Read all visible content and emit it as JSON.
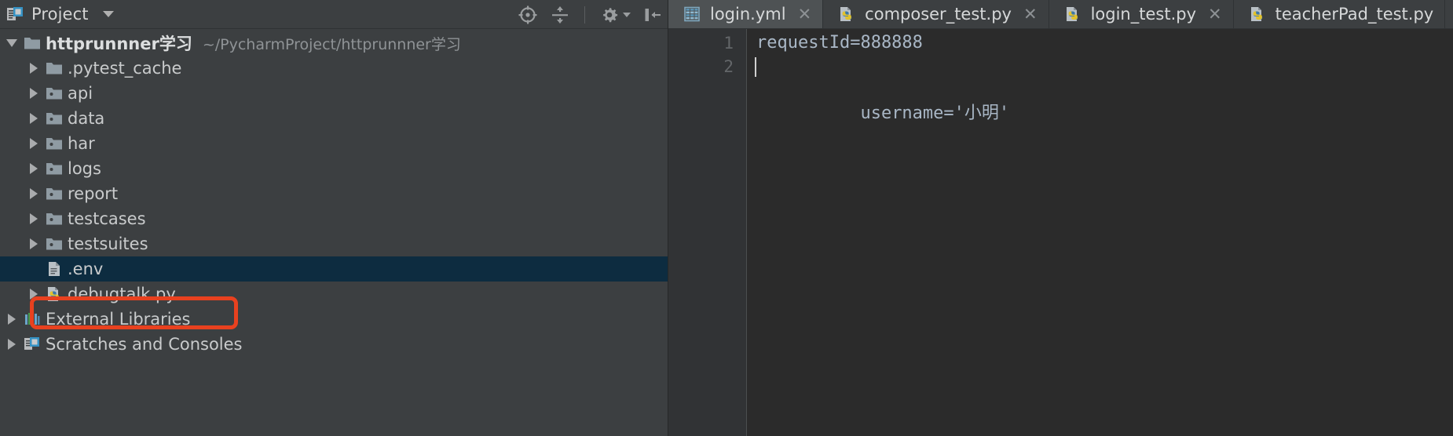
{
  "window": {
    "theme_bg": "#2b2b2b",
    "panel_bg": "#3c3f41",
    "accent_selection": "#0d2c40",
    "annotation_color": "#e8411f"
  },
  "sidebar": {
    "title": "Project",
    "title_icon": "project-icon",
    "dropdown_icon": "chevron-down-icon",
    "tools": [
      {
        "name": "locate-in-tree-icon",
        "label": "Select Opened File"
      },
      {
        "name": "collapse-all-icon",
        "label": "Collapse All"
      },
      {
        "name": "gear-icon",
        "label": "Settings"
      },
      {
        "name": "hide-panel-icon",
        "label": "Hide"
      }
    ],
    "tree": [
      {
        "indent": 0,
        "arrow": "open",
        "icon": "folder-icon",
        "label": "httprunnner学习",
        "bold": true,
        "path": "~/PycharmProject/httprunnner学习",
        "selected": false
      },
      {
        "indent": 1,
        "arrow": "closed",
        "icon": "folder-icon",
        "label": ".pytest_cache",
        "bold": false,
        "path": "",
        "selected": false
      },
      {
        "indent": 1,
        "arrow": "closed",
        "icon": "package-folder-icon",
        "label": "api",
        "bold": false,
        "path": "",
        "selected": false
      },
      {
        "indent": 1,
        "arrow": "closed",
        "icon": "package-folder-icon",
        "label": "data",
        "bold": false,
        "path": "",
        "selected": false
      },
      {
        "indent": 1,
        "arrow": "closed",
        "icon": "package-folder-icon",
        "label": "har",
        "bold": false,
        "path": "",
        "selected": false
      },
      {
        "indent": 1,
        "arrow": "closed",
        "icon": "package-folder-icon",
        "label": "logs",
        "bold": false,
        "path": "",
        "selected": false
      },
      {
        "indent": 1,
        "arrow": "closed",
        "icon": "package-folder-icon",
        "label": "report",
        "bold": false,
        "path": "",
        "selected": false
      },
      {
        "indent": 1,
        "arrow": "closed",
        "icon": "package-folder-icon",
        "label": "testcases",
        "bold": false,
        "path": "",
        "selected": false
      },
      {
        "indent": 1,
        "arrow": "closed",
        "icon": "package-folder-icon",
        "label": "testsuites",
        "bold": false,
        "path": "",
        "selected": false
      },
      {
        "indent": 1,
        "arrow": "none",
        "icon": "text-file-icon",
        "label": ".env",
        "bold": false,
        "path": "",
        "selected": true
      },
      {
        "indent": 1,
        "arrow": "closed",
        "icon": "python-file-icon",
        "label": "debugtalk.py",
        "bold": false,
        "path": "",
        "selected": false
      },
      {
        "indent": 0,
        "arrow": "closed",
        "icon": "external-libraries-icon",
        "label": "External Libraries",
        "bold": false,
        "path": "",
        "selected": false
      },
      {
        "indent": 0,
        "arrow": "closed",
        "icon": "scratches-icon",
        "label": "Scratches and Consoles",
        "bold": false,
        "path": "",
        "selected": false
      }
    ]
  },
  "editor": {
    "tabs": [
      {
        "label": "login.yml",
        "icon": "yaml-file-icon",
        "active": true,
        "closable": true
      },
      {
        "label": "composer_test.py",
        "icon": "python-file-icon",
        "active": false,
        "closable": true
      },
      {
        "label": "login_test.py",
        "icon": "python-file-icon",
        "active": false,
        "closable": true
      },
      {
        "label": "teacherPad_test.py",
        "icon": "python-file-icon",
        "active": false,
        "closable": false
      }
    ],
    "close_glyph": "✕",
    "lines": [
      {
        "no": "1",
        "text": "requestId=888888",
        "caret": false
      },
      {
        "no": "2",
        "text": "username='小明'",
        "caret": true
      }
    ]
  },
  "annotations": {
    "env_highlight_box": "red-rounded-rect-around-env",
    "pointer_arrow": "red-up-arrow-pointing-to-line-2"
  }
}
